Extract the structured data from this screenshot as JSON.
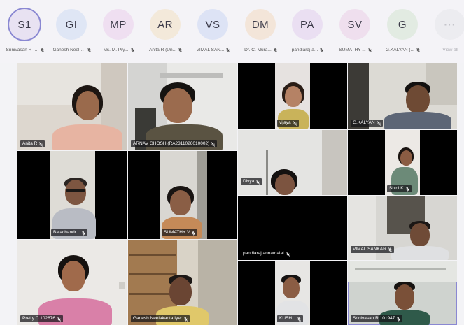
{
  "participants_strip": [
    {
      "initials": "S1",
      "name": "Srinivasan R 10...",
      "avatar_color": "#e8e2f2",
      "active": true
    },
    {
      "initials": "GI",
      "name": "Ganesh Neelak...",
      "avatar_color": "#dfe6f5",
      "active": false
    },
    {
      "initials": "MP",
      "name": "Ms. M. Pry...",
      "avatar_color": "#efdff1",
      "active": false
    },
    {
      "initials": "AR",
      "name": "Anita R (Un...",
      "avatar_color": "#f3e9da",
      "active": false
    },
    {
      "initials": "VS",
      "name": "VIMAL SAN...",
      "avatar_color": "#dde3f5",
      "active": false
    },
    {
      "initials": "DM",
      "name": "Dr. C. Mura...",
      "avatar_color": "#f3e5d9",
      "active": false
    },
    {
      "initials": "PA",
      "name": "pandiaraj a...",
      "avatar_color": "#eadff2",
      "active": false
    },
    {
      "initials": "SV",
      "name": "SUMATHY ...",
      "avatar_color": "#efdfee",
      "active": false
    },
    {
      "initials": "G",
      "name": "G.KALYAN (...",
      "avatar_color": "#e2ebe2",
      "active": false
    }
  ],
  "more": {
    "glyph": "···",
    "label": "View all"
  },
  "tiles": [
    {
      "label": "Anita R"
    },
    {
      "label": "ARNAV GHOSH (RA2311026010002)"
    },
    {
      "label": "vijaya"
    },
    {
      "label": "G.KALYAN"
    },
    {
      "label": "Divya"
    },
    {
      "label": "Shini K"
    },
    {
      "label": "Balachandr..."
    },
    {
      "label": "SUMATHY V"
    },
    {
      "label": "pandiaraj annamalai"
    },
    {
      "label": "VIMAL SANKAR"
    },
    {
      "label": "Pretty C 102676"
    },
    {
      "label": "Ganesh Neelakanta Iyer"
    },
    {
      "label": "KUSH..."
    },
    {
      "label": "Srinivasan R 101947"
    }
  ],
  "colors": {
    "strip_bg": "#f4f3f7",
    "grid_bg": "#f3f3f6",
    "active_ring": "#8a88d2",
    "label_bg": "#141418"
  }
}
